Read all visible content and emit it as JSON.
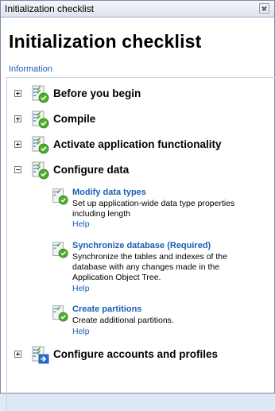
{
  "window": {
    "title": "Initialization checklist"
  },
  "page": {
    "title": "Initialization checklist",
    "info_link": "Information"
  },
  "nodes": [
    {
      "label": "Before you begin",
      "expanded": false,
      "icon": "checklist-complete-icon"
    },
    {
      "label": "Compile",
      "expanded": false,
      "icon": "checklist-complete-icon"
    },
    {
      "label": "Activate application functionality",
      "expanded": false,
      "icon": "checklist-complete-icon"
    },
    {
      "label": "Configure data",
      "expanded": true,
      "icon": "checklist-complete-icon"
    },
    {
      "label": "Configure accounts and profiles",
      "expanded": false,
      "icon": "checklist-next-icon"
    }
  ],
  "configure_data_items": [
    {
      "title": "Modify data types",
      "description": "Set up application-wide data type properties including length",
      "help": "Help"
    },
    {
      "title": "Synchronize database (Required)",
      "description": "Synchronize the tables and indexes of the database with any changes made in the Application Object Tree.",
      "help": "Help"
    },
    {
      "title": "Create partitions",
      "description": "Create additional partitions.",
      "help": "Help"
    }
  ],
  "colors": {
    "link": "#1a5fb4",
    "check_green": "#3a9a2a",
    "next_blue": "#2a6ad0"
  }
}
